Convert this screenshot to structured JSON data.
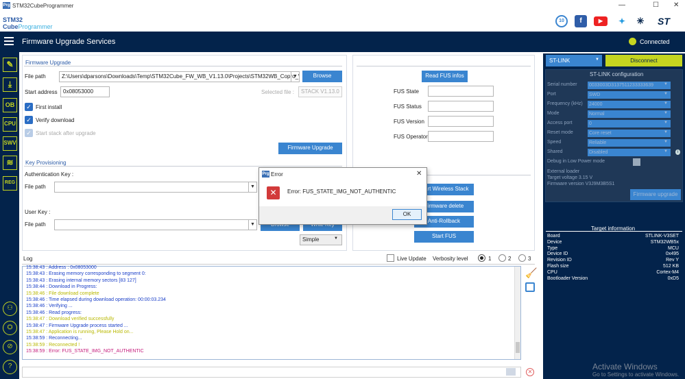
{
  "window": {
    "title": "STM32CubeProgrammer",
    "app_icon": "Prg",
    "min": "—",
    "max": "☐",
    "close": "✕"
  },
  "logo": {
    "line1": "STM32",
    "line2a": "Cube",
    "line2b": "Programmer"
  },
  "social": [
    "badge-10-icon",
    "facebook-icon",
    "youtube-icon",
    "twitter-icon",
    "network-icon",
    "st-logo-icon"
  ],
  "header": {
    "title": "Firmware Upgrade Services",
    "status": "Connected"
  },
  "sidebar": {
    "items": [
      "✎",
      "⤓",
      "OB",
      "CPU",
      "SWV",
      "≋",
      "REG"
    ],
    "bottom": [
      "⚇",
      "⛭",
      "⊘",
      "?"
    ]
  },
  "fw": {
    "section": "Firmware Upgrade",
    "file_path_label": "File path",
    "file_path": "Z:\\Users\\dparsons\\Downloads\\Temp\\STM32Cube_FW_WB_V1.13.0\\Projects\\STM32WB_Copro_W",
    "browse": "Browse",
    "start_address_label": "Start address",
    "start_address": "0x08053000",
    "selected_file_label": "Selected file :",
    "selected_file": "STACK V1.13.0",
    "first_install": "First install",
    "verify_download": "Verify download",
    "start_stack": "Start stack after upgrade",
    "upgrade_btn": "Firmware Upgrade"
  },
  "fus": {
    "read_btn": "Read FUS infos",
    "state": "FUS State",
    "status": "FUS Status",
    "version": "FUS Version",
    "operator": "FUS Operator",
    "start_wireless": "Start Wireless Stack",
    "fw_delete": "Firmware delete",
    "anti_rollback": "Anti-Rollback",
    "start_fus": "Start FUS"
  },
  "key": {
    "section": "Key Provisioning",
    "auth_label": "Authentication Key :",
    "file_path": "File path",
    "user_label": "User Key :",
    "browse": "Browse",
    "write_key": "Write Key",
    "mode": "Simple"
  },
  "dialog": {
    "icon": "Prg",
    "title": "Error",
    "message": "Error: FUS_STATE_IMG_NOT_AUTHENTIC",
    "ok": "OK",
    "close": "✕"
  },
  "log": {
    "title": "Log",
    "live_update": "Live Update",
    "verbosity": "Verbosity level",
    "levels": [
      "1",
      "2",
      "3"
    ],
    "lines": [
      {
        "text": "15:38:43 :    Address      : 0x08053000",
        "color": "#1a3fc8"
      },
      {
        "text": "15:38:43 : Erasing memory corresponding to segment 0:",
        "color": "#1a3fc8"
      },
      {
        "text": "15:38:43 : Erasing internal memory sectors [83 127]",
        "color": "#1a3fc8"
      },
      {
        "text": "15:38:44 : Download in Progress:",
        "color": "#1a3fc8"
      },
      {
        "text": "15:38:46 : File download complete",
        "color": "#b8b800"
      },
      {
        "text": "15:38:46 : Time elapsed during download operation: 00:00:03.234",
        "color": "#1a3fc8"
      },
      {
        "text": "15:38:46 : Verifying ...",
        "color": "#1a3fc8"
      },
      {
        "text": "15:38:46 : Read progress:",
        "color": "#1a3fc8"
      },
      {
        "text": "15:38:47 : Download verified successfully",
        "color": "#b8b800"
      },
      {
        "text": "15:38:47 : Firmware Upgrade process started ...",
        "color": "#1a3fc8"
      },
      {
        "text": "15:38:47 : Application is running, Please Hold on...",
        "color": "#b8b800"
      },
      {
        "text": "15:38:59 : Reconnecting...",
        "color": "#1a3fc8"
      },
      {
        "text": "15:38:59 : Reconnected !",
        "color": "#b8b800"
      },
      {
        "text": "15:38:59 : Error: FUS_STATE_IMG_NOT_AUTHENTIC",
        "color": "#c41a7a"
      }
    ]
  },
  "stlink": {
    "dropdown": "ST-LINK",
    "disconnect": "Disconnect",
    "config_title": "ST-LINK configuration",
    "fields": [
      {
        "label": "Serial number",
        "value": "0033003D3137511233333639"
      },
      {
        "label": "Port",
        "value": "SWD"
      },
      {
        "label": "Frequency (kHz)",
        "value": "24000"
      },
      {
        "label": "Mode",
        "value": "Normal"
      },
      {
        "label": "Access port",
        "value": "0"
      },
      {
        "label": "Reset mode",
        "value": "Core reset"
      },
      {
        "label": "Speed",
        "value": "Reliable"
      },
      {
        "label": "Shared",
        "value": "Disabled"
      }
    ],
    "debug_low_power": "Debug in Low Power mode",
    "ext_loader": "External loader",
    "target_voltage": "Target voltage     3.15 V",
    "fw_version": "Firmware version  V3J9M3B5S1",
    "fw_upgrade": "Firmware upgrade"
  },
  "target": {
    "title": "Target information",
    "rows": [
      {
        "k": "Board",
        "v": "STLINK-V3SET"
      },
      {
        "k": "Device",
        "v": "STM32WB5x"
      },
      {
        "k": "Type",
        "v": "MCU"
      },
      {
        "k": "Device ID",
        "v": "0x495"
      },
      {
        "k": "Revision ID",
        "v": "Rev Y"
      },
      {
        "k": "Flash size",
        "v": "512 KB"
      },
      {
        "k": "CPU",
        "v": "Cortex-M4"
      },
      {
        "k": "Bootloader Version",
        "v": "0xD5"
      }
    ]
  },
  "watermark": {
    "line1": "Activate Windows",
    "line2": "Go to Settings to activate Windows."
  },
  "colors": {
    "navy": "#03234b",
    "accent": "#3a85d0",
    "lime": "#c5d520"
  }
}
